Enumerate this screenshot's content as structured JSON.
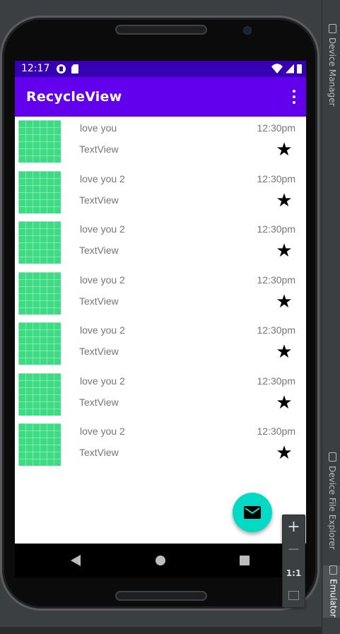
{
  "status_bar": {
    "time": "12:17"
  },
  "app_bar": {
    "title": "RecycleView"
  },
  "list": {
    "items": [
      {
        "title": "love you",
        "subtitle": "TextView",
        "time": "12:30pm",
        "star": "★"
      },
      {
        "title": "love you 2",
        "subtitle": "TextView",
        "time": "12:30pm",
        "star": "★"
      },
      {
        "title": "love you 2",
        "subtitle": "TextView",
        "time": "12:30pm",
        "star": "★"
      },
      {
        "title": "love you 2",
        "subtitle": "TextView",
        "time": "12:30pm",
        "star": "★"
      },
      {
        "title": "love you 2",
        "subtitle": "TextView",
        "time": "12:30pm",
        "star": "★"
      },
      {
        "title": "love you 2",
        "subtitle": "TextView",
        "time": "12:30pm",
        "star": "★"
      },
      {
        "title": "love you 2",
        "subtitle": "TextView",
        "time": "12:30pm",
        "star": "★"
      }
    ]
  },
  "fab": {
    "icon": "mail-icon"
  },
  "zoom_panel": {
    "zoom_in": "+",
    "zoom_out": "−",
    "actual_size": "1:1"
  },
  "tool_strip": {
    "device_manager": "Device Manager",
    "device_file_explorer": "Device File Explorer",
    "emulator": "Emulator"
  },
  "colors": {
    "status_bar": "#3700b3",
    "app_bar": "#6200ee",
    "fab": "#03dac5",
    "thumbnail": "#3ddc84"
  }
}
